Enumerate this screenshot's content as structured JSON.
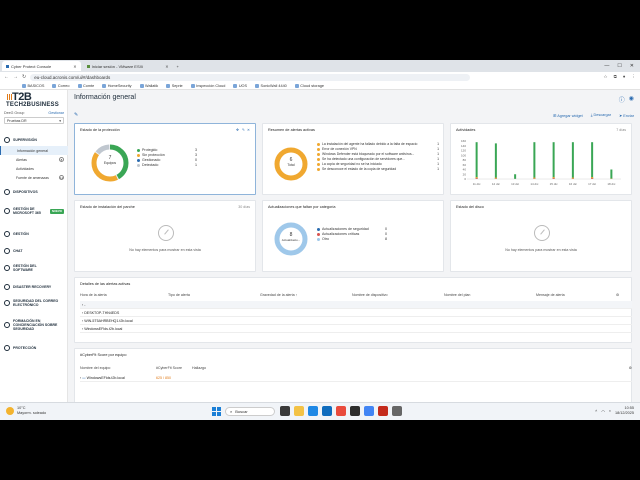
{
  "browser": {
    "tabs": [
      {
        "label": "Cyber Protect Console",
        "active": true
      },
      {
        "label": "Iniciar sesión - VMware ESXi",
        "active": false
      }
    ],
    "url": "eu-cloud.acronis.com/ui/#/dashboards",
    "bookmarks": [
      "BASICOS",
      "Correo",
      "Comte",
      "HomeSecurity",
      "Wallatik",
      "Seprie",
      "Inspección Cloud",
      "UOS",
      "SonicWall 4440",
      "Cloud storage"
    ]
  },
  "sidebar": {
    "logo_top": "T2B",
    "logo_sub": "TECH2BUSINESS",
    "org_label": "DeeG Group",
    "org_switch": "Gestionar",
    "org_select": "Pruebas DR",
    "sections": [
      {
        "label": "SUPERVISIÓN",
        "icon": "monitor-icon"
      },
      {
        "label": "DISPOSITIVOS",
        "icon": "devices-icon"
      },
      {
        "label": "GESTIÓN DE MICROSOFT 365",
        "icon": "microsoft-icon",
        "badge": "NUEVO"
      },
      {
        "label": "GESTIÓN",
        "icon": "management-icon"
      },
      {
        "label": "CHAT",
        "icon": "chat-icon"
      },
      {
        "label": "GESTIÓN DEL SOFTWARE",
        "icon": "software-icon"
      },
      {
        "label": "DISASTER RECOVERY",
        "icon": "disaster-recovery-icon"
      },
      {
        "label": "SEGURIDAD DEL CORREO ELECTRÓNICO",
        "icon": "email-security-icon"
      },
      {
        "label": "FORMACIÓN EN CONCIENCIACIÓN SOBRE SEGURIDAD",
        "icon": "training-icon"
      },
      {
        "label": "PROTECCIÓN",
        "icon": "protection-icon"
      }
    ],
    "subitems": [
      {
        "label": "Información general",
        "selected": true
      },
      {
        "label": "Alertas",
        "count": "8"
      },
      {
        "label": "Actividades",
        "count": ""
      },
      {
        "label": "Fuente de amenazas",
        "count": "11"
      }
    ]
  },
  "main": {
    "title": "Información general",
    "toolbar": {
      "add": "Agregar widget",
      "download": "Descargar",
      "send": "Enviar"
    },
    "protection": {
      "title": "Estado de la protección",
      "total": "7",
      "total_label": "Equipos",
      "legend": [
        {
          "label": "Protegido",
          "value": "3",
          "color": "#3aa655"
        },
        {
          "label": "Sin protección",
          "value": "3",
          "color": "#f0a830"
        },
        {
          "label": "Gestionado",
          "value": "0",
          "color": "#2a6bb0"
        },
        {
          "label": "Detectado",
          "value": "1",
          "color": "#c0c7cf"
        }
      ],
      "shares": [
        3,
        3,
        0,
        1
      ]
    },
    "active_alerts": {
      "title": "Resumen de alertas activas",
      "total": "6",
      "total_label": "Total",
      "items": [
        {
          "label": "La instalación del agente ha fallado debido a la falta de espacio",
          "value": "1"
        },
        {
          "label": "Error de conexión VPN",
          "value": "1"
        },
        {
          "label": "Windows Defender está bloqueado por el software antivirus...",
          "value": "1"
        },
        {
          "label": "Se ha detectado una configuración de servidores que...",
          "value": "1"
        },
        {
          "label": "La copia de seguridad no se ha iniciado",
          "value": "1"
        },
        {
          "label": "Se desconoce el estado de la copia de seguridad",
          "value": "1"
        }
      ]
    },
    "activities": {
      "title": "Actividades",
      "range": "7 días",
      "chart_data": {
        "type": "bar",
        "categories": [
          "11 dic",
          "12 dic",
          "13 dic",
          "14 dic",
          "15 dic",
          "16 dic",
          "17 dic",
          "18 dic"
        ],
        "series": [
          {
            "values": [
              155,
              150,
              20,
              155,
              155,
              155,
              155,
              40
            ],
            "color": "#3aa655"
          },
          {
            "values": [
              8,
              6,
              0,
              6,
              8,
              6,
              8,
              2
            ],
            "color": "#f0a830"
          },
          {
            "values": [
              4,
              2,
              0,
              2,
              4,
              2,
              4,
              0
            ],
            "color": "#d9534f"
          }
        ],
        "yticks": [
          "160",
          "140",
          "120",
          "100",
          "80",
          "60",
          "40",
          "20",
          "0"
        ],
        "ylim": [
          0,
          160
        ]
      }
    },
    "patch": {
      "title": "Estado de instalación del parche",
      "range": "30 días",
      "empty": "No hay elementos para mostrar en esta vista"
    },
    "missing_updates": {
      "title": "Actualizaciones que faltan por categoría",
      "total": "8",
      "total_label": "Actualizacio...",
      "items": [
        {
          "label": "Actualizaciones de seguridad",
          "value": "0"
        },
        {
          "label": "Actualizaciones críticas",
          "value": "0"
        },
        {
          "label": "Otro",
          "value": "8"
        }
      ]
    },
    "disk": {
      "title": "Estado del disco",
      "empty": "No hay elementos para mostrar en esta vista"
    },
    "alerts_detail": {
      "title": "Detalles de las alertas activas",
      "columns": [
        "Hora de la alerta",
        "Tipo de alerta",
        "Gravedad de la alerta ↑",
        "Nombre de dispositivo",
        "Nombre del plan",
        "Mensaje de alerta"
      ],
      "rows": [
        "-",
        "DESKTOP-THN4EDS",
        "WIN-5T5AHRBEHQ1.t2b.local",
        "WindowsEFlds.t2b.local"
      ]
    },
    "cyberfit": {
      "title": "#CyberFit Score por equipo",
      "columns": [
        "Nombre del equipo",
        "#CyberFit Score",
        "Hallazgo"
      ],
      "rows": [
        {
          "name": "WindowsEFlds.t2b.local",
          "score": "625 / 850"
        }
      ]
    }
  },
  "taskbar": {
    "temp": "10°C",
    "weather": "Mayorm. soleado",
    "search": "Buscar",
    "time": "10:55",
    "date": "18/12/2025"
  }
}
